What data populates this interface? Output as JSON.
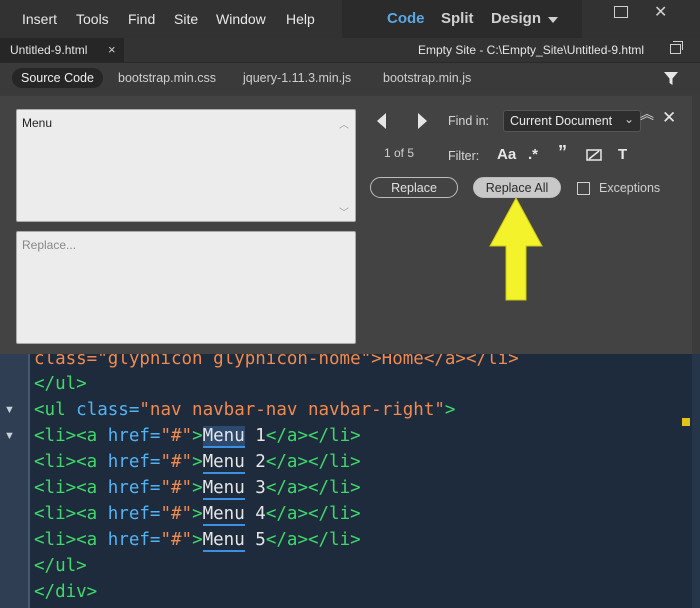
{
  "menubar": {
    "items": [
      "Insert",
      "Tools",
      "Find",
      "Site",
      "Window",
      "Help"
    ],
    "views": [
      "Code",
      "Split",
      "Design"
    ]
  },
  "doc_tab": {
    "title": "Untitled-9.html",
    "close": "×",
    "site_path": "Empty Site - C:\\Empty_Site\\Untitled-9.html"
  },
  "related_files": {
    "items": [
      "Source Code",
      "bootstrap.min.css",
      "jquery-1.11.3.min.js",
      "bootstrap.min.js"
    ]
  },
  "find_panel": {
    "find_text": "Menu",
    "replace_placeholder": "Replace...",
    "find_in_label": "Find in:",
    "find_in_value": "Current Document",
    "match_count": "1 of 5",
    "filter_label": "Filter:",
    "filter_options": [
      "Aa",
      ".*",
      "99",
      "ꝳ",
      "T"
    ],
    "replace_label": "Replace",
    "replace_all_label": "Replace All",
    "exceptions_label": "Exceptions",
    "exceptions_checked": false
  },
  "code": {
    "lines": [
      "class=\"glyphicon glyphicon-home\">Home</a></li>",
      "</ul>",
      "<ul class=\"nav navbar-nav navbar-right\">",
      "<li><a href=\"#\">Menu 1</a></li>",
      "<li><a href=\"#\">Menu 2</a></li>",
      "<li><a href=\"#\">Menu 3</a></li>",
      "<li><a href=\"#\">Menu 4</a></li>",
      "<li><a href=\"#\">Menu 5</a></li>",
      "</ul>",
      "</div>"
    ]
  },
  "colors": {
    "tag": "#3fd96a",
    "attr": "#52b4f5",
    "string": "#f38a4d",
    "editor_bg": "#1d2b3c",
    "active_view": "#5aa7e6",
    "annotation_arrow": "#f3f22b"
  }
}
